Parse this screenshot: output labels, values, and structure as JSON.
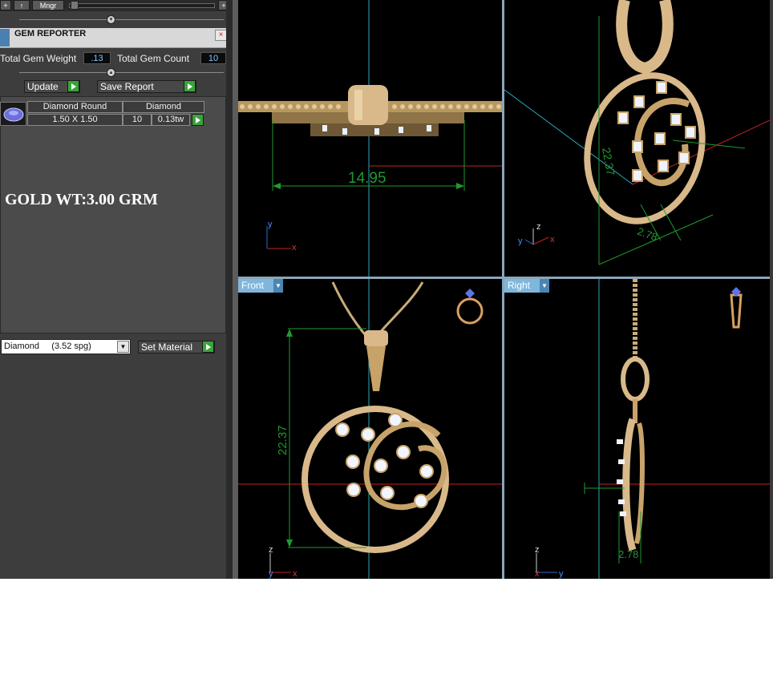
{
  "toolbar": {
    "up_arrow": "↑",
    "mngr_label": "Mngr",
    "plus_label": "+"
  },
  "gem_reporter": {
    "title": "GEM REPORTER",
    "close": "×",
    "total_gem_weight_label": "Total Gem Weight",
    "total_gem_weight_value": ".13",
    "total_gem_count_label": "Total Gem Count",
    "total_gem_count_value": "10",
    "update_label": "Update",
    "save_report_label": "Save Report",
    "columns": [
      "Diamond Round",
      "Diamond"
    ],
    "row": {
      "size": "1.50 X 1.50",
      "count": "10",
      "weight": "0.13tw"
    },
    "note": "GOLD WT:3.00 GRM",
    "material_select": "Diamond     (3.52 spg)",
    "set_material_label": "Set Material"
  },
  "viewports": {
    "top": {
      "dimension": "14.95",
      "axis_y": "y",
      "axis_x": "x"
    },
    "perspective": {
      "dimension_a": "22.37",
      "dimension_b": "2.78",
      "axis_z": "z",
      "axis_y": "y",
      "axis_x": "x"
    },
    "front": {
      "label": "Front",
      "dimension": "22.37",
      "axis_z": "z",
      "axis_y": "y",
      "axis_x": "x"
    },
    "right": {
      "label": "Right",
      "dimension": "2.78",
      "axis_z": "z",
      "axis_x": "x",
      "axis_y": "y"
    }
  },
  "colors": {
    "gold": "#d9b98a",
    "dimension_green": "#1f9a2e",
    "axis_red": "#c42222",
    "axis_cyan": "#2aa7b8",
    "viewport_label": "#7fb6dc"
  }
}
